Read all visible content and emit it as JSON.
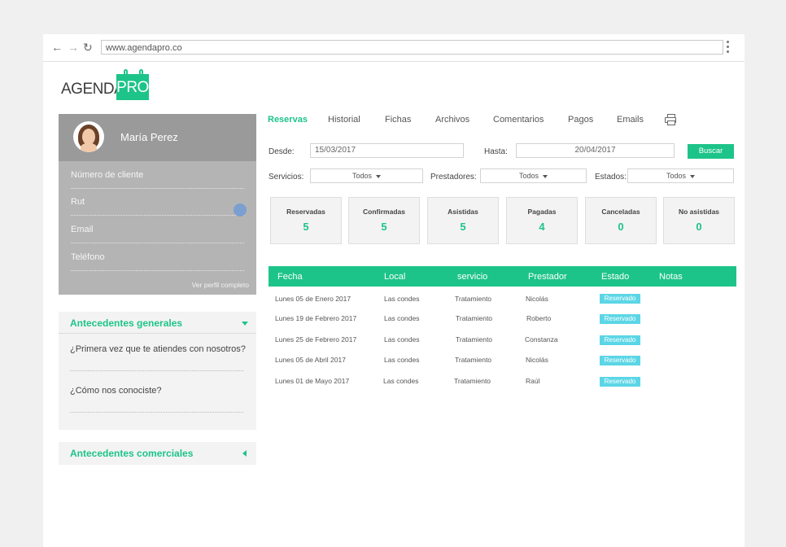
{
  "browser": {
    "url": "www.agendapro.co",
    "back_icon": "arrow-left-icon",
    "forward_icon": "arrow-right-icon",
    "reload_icon": "reload-icon"
  },
  "logo": {
    "text_left": "AGENDA",
    "text_right": "PRO"
  },
  "profile": {
    "name": "María Perez",
    "fields": [
      "Número de cliente",
      "Rut",
      "Email",
      "Teléfono"
    ],
    "link": "Ver perfil completo"
  },
  "accordion_general": {
    "title": "Antecedentes generales",
    "questions": [
      "¿Primera vez que te atiendes con nosotros?",
      "¿Cómo nos conociste?"
    ]
  },
  "accordion_commercial": {
    "title": "Antecedentes comerciales"
  },
  "tabs": [
    "Reservas",
    "Historial",
    "Fichas",
    "Archivos",
    "Comentarios",
    "Pagos",
    "Emails"
  ],
  "filters": {
    "desde_label": "Desde:",
    "desde_value": "15/03/2017",
    "hasta_label": "Hasta:",
    "hasta_value": "20/04/2017",
    "search_button": "Buscar",
    "servicios_label": "Servicios:",
    "servicios_value": "Todos",
    "prestadores_label": "Prestadores:",
    "prestadores_value": "Todos",
    "estados_label": "Estados:",
    "estados_value": "Todos"
  },
  "stats": [
    {
      "label": "Reservadas",
      "value": "5"
    },
    {
      "label": "Confirmadas",
      "value": "5"
    },
    {
      "label": "Asistidas",
      "value": "5"
    },
    {
      "label": "Pagadas",
      "value": "4"
    },
    {
      "label": "Canceladas",
      "value": "0"
    },
    {
      "label": "No asistidas",
      "value": "0"
    }
  ],
  "table": {
    "headers": [
      "Fecha",
      "Local",
      "servicio",
      "Prestador",
      "Estado",
      "Notas"
    ],
    "rows": [
      {
        "fecha": "Lunes 05 de Enero 2017",
        "local": "Las condes",
        "servicio": "Tratamiento",
        "prestador": "Nicolás",
        "estado": "Reservado"
      },
      {
        "fecha": "Lunes 19 de Febrero 2017",
        "local": "Las condes",
        "servicio": "Tratamiento",
        "prestador": "Roberto",
        "estado": "Reservado"
      },
      {
        "fecha": "Lunes 25 de Febrero 2017",
        "local": "Las condes",
        "servicio": "Tratamiento",
        "prestador": "Constanza",
        "estado": "Reservado"
      },
      {
        "fecha": "Lunes 05 de Abril 2017",
        "local": "Las condes",
        "servicio": "Tratamiento",
        "prestador": "Nicolás",
        "estado": "Reservado"
      },
      {
        "fecha": "Lunes 01 de Mayo 2017",
        "local": "Las condes",
        "servicio": "Tratamiento",
        "prestador": "Raúl",
        "estado": "Reservado"
      }
    ]
  },
  "colors": {
    "accent": "#1dc489",
    "badge": "#5cd6e6",
    "panel": "#9a9a9a"
  }
}
